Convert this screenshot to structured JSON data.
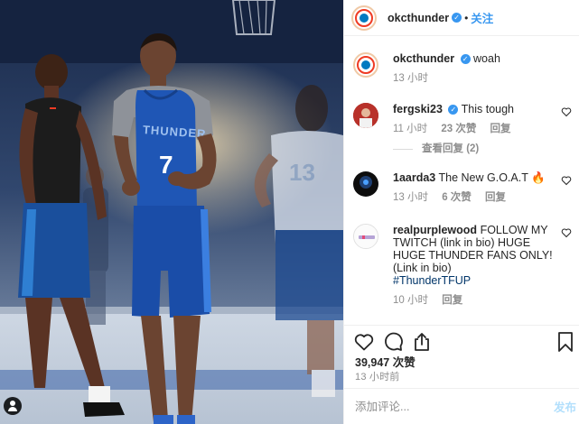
{
  "header": {
    "username": "okcthunder",
    "separator": "•",
    "follow_label": "关注"
  },
  "caption": {
    "username": "okcthunder",
    "text": "woah",
    "time": "13 小时"
  },
  "comments": [
    {
      "username": "fergski23",
      "verified": true,
      "text": "This tough",
      "time": "11 小时",
      "likes": "23 次赞",
      "reply": "回复",
      "view_replies": "查看回复 (2)"
    },
    {
      "username": "1aarda3",
      "verified": false,
      "text": "The New G.O.A.T 🔥",
      "time": "13 小时",
      "likes": "6 次赞",
      "reply": "回复"
    },
    {
      "username": "realpurplewood",
      "verified": false,
      "text": "FOLLOW MY TWITCH (link in bio) HUGE HUGE THUNDER FANS ONLY! (Link in bio)",
      "hashtag": "#ThunderTFUP",
      "time": "10 小时",
      "reply": "回复"
    }
  ],
  "footer": {
    "likes": "39,947 次赞",
    "time_ago": "13 小时前",
    "comment_placeholder": "添加评论...",
    "post_label": "发布"
  },
  "photo": {
    "jersey_text": "THUNDER",
    "jersey_number": "7",
    "bg_player_number": "13"
  },
  "colors": {
    "accent_blue": "#3897f0",
    "thunder_blue": "#007ac1",
    "thunder_orange": "#ef3b24",
    "muted_text": "#8e8e8e"
  },
  "icons": {
    "like": "heart-icon",
    "comment": "comment-icon",
    "share": "share-icon",
    "save": "bookmark-icon",
    "verified": "verified-badge-icon",
    "fire": "fire-emoji"
  }
}
